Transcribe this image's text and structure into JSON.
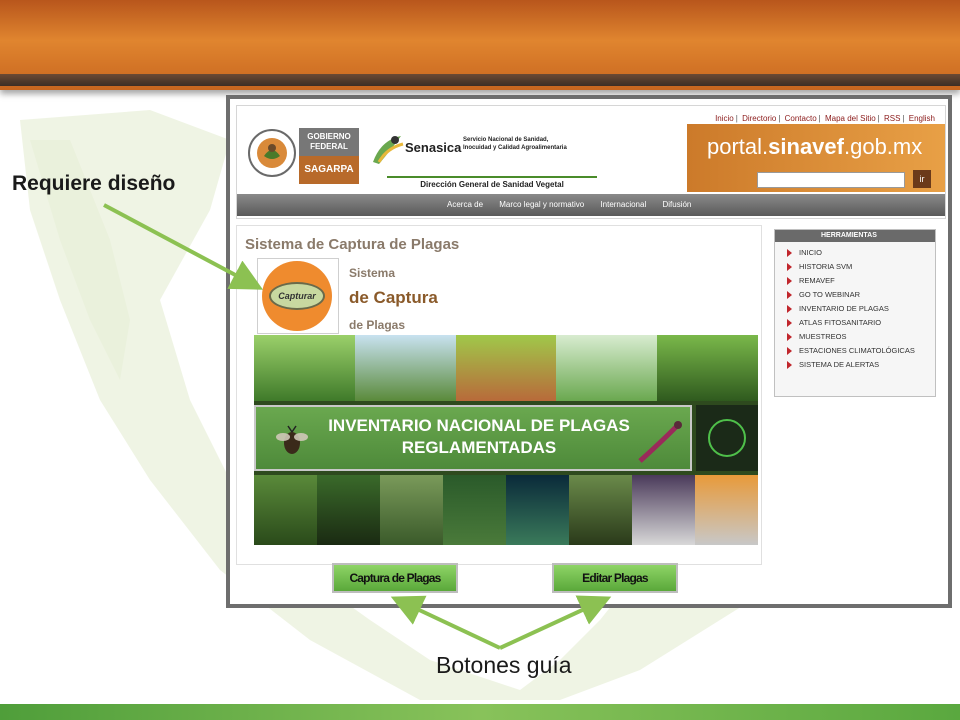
{
  "annotations": {
    "title_label": "Requiere diseño",
    "bottom_label": "Botones  guía"
  },
  "site": {
    "top_links": [
      "Inicio",
      "Directorio",
      "Contacto",
      "Mapa del Sitio",
      "RSS",
      "English"
    ],
    "portal": {
      "prefix": "portal.",
      "brand": "sinavef",
      "suffix": ".gob.mx"
    },
    "search": {
      "button_label": "ir",
      "value": ""
    },
    "gobierno": {
      "line1": "GOBIERNO",
      "line2": "FEDERAL",
      "agency": "SAGARPA"
    },
    "senasica": {
      "name": "Senasica",
      "description": [
        "Servicio Nacional de Sanidad,",
        "Inocuidad y Calidad Agroalimentaria"
      ]
    },
    "direccion": "Dirección General de Sanidad Vegetal",
    "nav": [
      "Acerca de",
      "Marco legal y normativo",
      "Internacional",
      "Difusión"
    ]
  },
  "content": {
    "section_title": "Sistema de Captura de Plagas",
    "logo_text": "Capturar",
    "title_lines": [
      "Sistema",
      "de Captura",
      "de Plagas"
    ],
    "banner_lines": [
      "INVENTARIO NACIONAL DE PLAGAS",
      "REGLAMENTADAS"
    ]
  },
  "herramientas": {
    "title": "HERRAMIENTAS",
    "items": [
      "INICIO",
      "HISTORIA SVM",
      "REMAVEF",
      "GO TO WEBINAR",
      "INVENTARIO DE PLAGAS",
      "ATLAS FITOSANITARIO",
      "MUESTREOS",
      "ESTACIONES CLIMATOLÓGICAS",
      "SISTEMA DE ALERTAS"
    ]
  },
  "buttons": {
    "captura": "Captura de Plagas",
    "editar": "Editar Plagas"
  },
  "colors": {
    "header_orange": "#e0852f",
    "accent_green": "#6aa84f",
    "arrow_green": "#8cc152",
    "link_red": "#8b1a1a"
  }
}
